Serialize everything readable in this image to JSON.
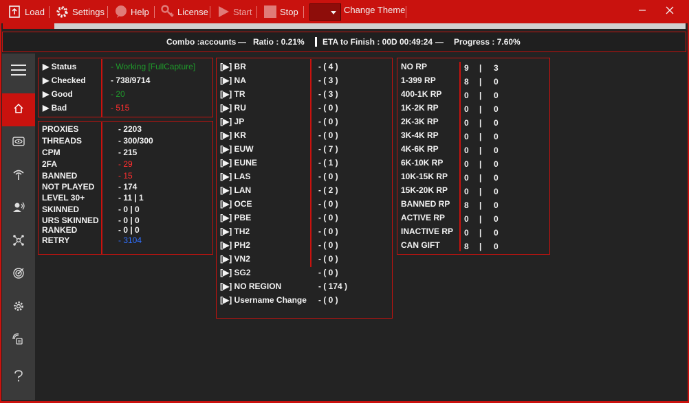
{
  "toolbar": {
    "load": "Load",
    "settings": "Settings",
    "help": "Help",
    "license": "License",
    "start": "Start",
    "stop": "Stop",
    "change_theme": "Change Theme"
  },
  "progress": {
    "fraction": 0.076
  },
  "infobar": {
    "combo": "Combo :accounts",
    "dash1": "—",
    "ratio": "Ratio : 0.21%",
    "eta": "ETA to Finish : 00D 00:49:24",
    "dash2": "—",
    "progress": "Progress : 7.60%"
  },
  "sidebar": {
    "items": [
      {
        "icon": "hamburger-menu-icon"
      },
      {
        "icon": "home-icon",
        "active": true
      },
      {
        "icon": "eye-icon"
      },
      {
        "icon": "satellite-dish-icon"
      },
      {
        "icon": "user-voice-icon"
      },
      {
        "icon": "network-icon"
      },
      {
        "icon": "target-icon"
      },
      {
        "icon": "gear-icon"
      },
      {
        "icon": "broadcast-icon"
      },
      {
        "icon": "question-icon"
      }
    ]
  },
  "status": {
    "rows": [
      {
        "label": "▶ Status",
        "value": "- Working [FullCapture]",
        "color": "green"
      },
      {
        "label": "▶ Checked",
        "value": "- 738/9714",
        "color": "white"
      },
      {
        "label": "▶ Good",
        "value": "- 20",
        "color": "green"
      },
      {
        "label": "▶ Bad",
        "value": "- 515",
        "color": "red"
      }
    ]
  },
  "stats": {
    "rows": [
      {
        "label": "PROXIES",
        "value": "- 2203",
        "color": "white"
      },
      {
        "label": "THREADS",
        "value": "- 300/300",
        "color": "white"
      },
      {
        "label": "CPM",
        "value": "- 215",
        "color": "white"
      },
      {
        "label": "2FA",
        "value": "- 29",
        "color": "red"
      },
      {
        "label": "BANNED",
        "value": "- 15",
        "color": "red"
      },
      {
        "label": "NOT PLAYED",
        "value": "- 174",
        "color": "white"
      },
      {
        "label": "LEVEL 30+",
        "value": "- 11 | 1",
        "color": "white"
      },
      {
        "label": "SKINNED",
        "value": "- 0 | 0",
        "color": "white"
      },
      {
        "label": "URS SKINNED",
        "value": "- 0 | 0",
        "color": "white"
      },
      {
        "label": "RANKED",
        "value": "- 0 | 0",
        "color": "white"
      },
      {
        "label": "RETRY",
        "value": "- 3104",
        "color": "blue"
      }
    ]
  },
  "regions": {
    "rows": [
      {
        "label": "[▶] BR",
        "value": "- ( 4 )"
      },
      {
        "label": "[▶] NA",
        "value": "- ( 3 )"
      },
      {
        "label": "[▶] TR",
        "value": "- ( 3 )"
      },
      {
        "label": "[▶] RU",
        "value": "- ( 0 )"
      },
      {
        "label": "[▶] JP",
        "value": "- ( 0 )"
      },
      {
        "label": "[▶] KR",
        "value": "- ( 0 )"
      },
      {
        "label": "[▶] EUW",
        "value": "- ( 7 )"
      },
      {
        "label": "[▶] EUNE",
        "value": "- ( 1 )"
      },
      {
        "label": "[▶] LAS",
        "value": "- ( 0 )"
      },
      {
        "label": "[▶] LAN",
        "value": "- ( 2 )"
      },
      {
        "label": "[▶] OCE",
        "value": "- ( 0 )"
      },
      {
        "label": "[▶] PBE",
        "value": "- ( 0 )"
      },
      {
        "label": "[▶] TH2",
        "value": "- ( 0 )"
      },
      {
        "label": "[▶] PH2",
        "value": "- ( 0 )"
      },
      {
        "label": "[▶] VN2",
        "value": "- ( 0 )"
      },
      {
        "label": "[▶] SG2",
        "value": "- ( 0 )"
      },
      {
        "label": "[▶] NO REGION",
        "value": "- ( 174 )"
      },
      {
        "label": "[▶] Username Change",
        "value": "- ( 0 )"
      }
    ]
  },
  "rp": {
    "rows": [
      {
        "label": "NO RP",
        "a": "9",
        "sep": "|",
        "b": "3"
      },
      {
        "label": "1-399 RP",
        "a": "8",
        "sep": "|",
        "b": "0"
      },
      {
        "label": "400-1K RP",
        "a": "0",
        "sep": "|",
        "b": "0"
      },
      {
        "label": "1K-2K RP",
        "a": "0",
        "sep": "|",
        "b": "0"
      },
      {
        "label": "2K-3K RP",
        "a": "0",
        "sep": "|",
        "b": "0"
      },
      {
        "label": "3K-4K RP",
        "a": "0",
        "sep": "|",
        "b": "0"
      },
      {
        "label": "4K-6K RP",
        "a": "0",
        "sep": "|",
        "b": "0"
      },
      {
        "label": "6K-10K RP",
        "a": "0",
        "sep": "|",
        "b": "0"
      },
      {
        "label": "10K-15K RP",
        "a": "0",
        "sep": "|",
        "b": "0"
      },
      {
        "label": "15K-20K RP",
        "a": "0",
        "sep": "|",
        "b": "0"
      },
      {
        "label": "BANNED RP",
        "a": "8",
        "sep": "|",
        "b": "0"
      },
      {
        "label": "ACTIVE RP",
        "a": "0",
        "sep": "|",
        "b": "0"
      },
      {
        "label": "INACTIVE RP",
        "a": "0",
        "sep": "|",
        "b": "0"
      },
      {
        "label": "CAN GIFT",
        "a": "8",
        "sep": "|",
        "b": "0"
      }
    ]
  },
  "colors": {
    "accent": "#c9120e",
    "green": "#1f9a2b",
    "red": "#ff2e2e",
    "blue": "#2f6fff"
  }
}
